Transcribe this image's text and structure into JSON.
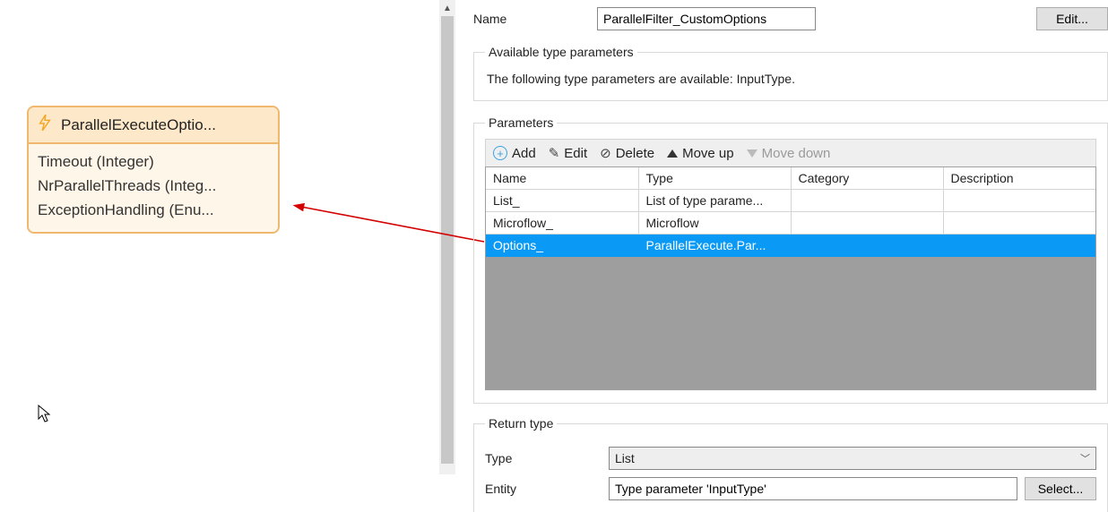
{
  "entity": {
    "title": "ParallelExecuteOptio...",
    "attributes": [
      "Timeout (Integer)",
      "NrParallelThreads (Integ...",
      "ExceptionHandling (Enu..."
    ]
  },
  "form": {
    "name_label": "Name",
    "name_value": "ParallelFilter_CustomOptions",
    "edit_btn": "Edit..."
  },
  "type_params": {
    "legend": "Available type parameters",
    "text": "The following type parameters are available: InputType."
  },
  "parameters": {
    "legend": "Parameters",
    "toolbar": {
      "add": "Add",
      "edit": "Edit",
      "delete": "Delete",
      "move_up": "Move up",
      "move_down": "Move down"
    },
    "columns": [
      "Name",
      "Type",
      "Category",
      "Description"
    ],
    "rows": [
      {
        "name": "List_",
        "type": "List of type parame...",
        "category": "",
        "description": "",
        "selected": false
      },
      {
        "name": "Microflow_",
        "type": "Microflow",
        "category": "",
        "description": "",
        "selected": false
      },
      {
        "name": "Options_",
        "type": "ParallelExecute.Par...",
        "category": "",
        "description": "",
        "selected": true
      }
    ]
  },
  "return_type": {
    "legend": "Return type",
    "type_label": "Type",
    "type_value": "List",
    "entity_label": "Entity",
    "entity_value": "Type parameter 'InputType'",
    "select_btn": "Select..."
  }
}
